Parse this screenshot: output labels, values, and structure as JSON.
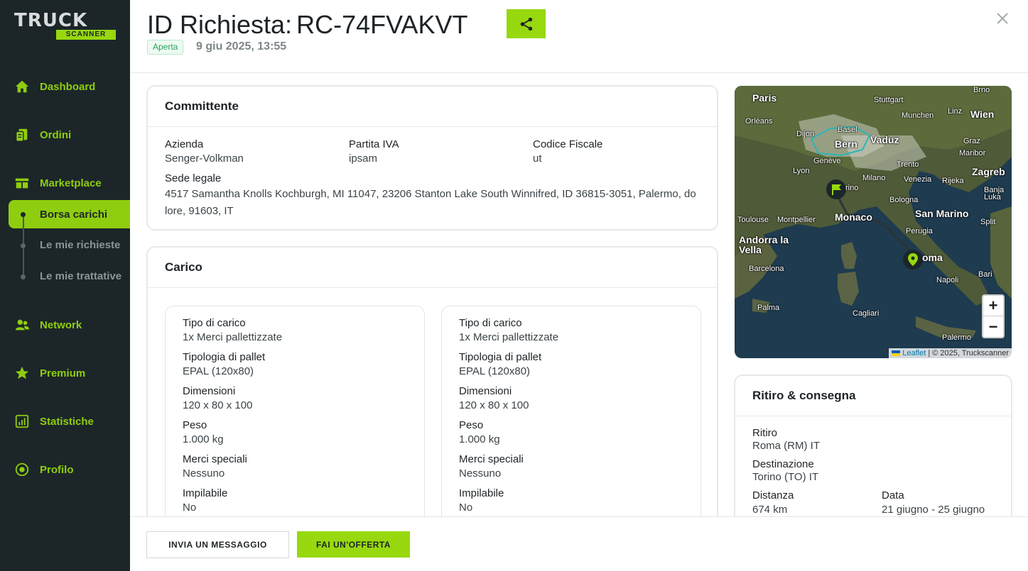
{
  "sidebar": {
    "logo_top": "TRUCK",
    "logo_bottom": "SCANNER",
    "items": [
      {
        "label": "Dashboard",
        "icon": "home-icon"
      },
      {
        "label": "Ordini",
        "icon": "orders-icon"
      },
      {
        "label": "Marketplace",
        "icon": "marketplace-icon"
      },
      {
        "label": "Network",
        "icon": "network-icon"
      },
      {
        "label": "Premium",
        "icon": "star-icon"
      },
      {
        "label": "Statistiche",
        "icon": "chart-icon"
      },
      {
        "label": "Profilo",
        "icon": "profile-icon"
      }
    ],
    "sub_items": [
      {
        "label": "Borsa carichi",
        "active": true
      },
      {
        "label": "Le mie richieste",
        "active": false
      },
      {
        "label": "Le mie trattative",
        "active": false
      }
    ]
  },
  "header": {
    "title": "ID Richiesta:",
    "request_id": "RC-74FVAKVT",
    "status": "Aperta",
    "date": "9 giu 2025, 13:55"
  },
  "committente": {
    "title": "Committente",
    "azienda_label": "Azienda",
    "azienda_value": "Senger-Volkman",
    "piva_label": "Partita IVA",
    "piva_value": "ipsam",
    "cf_label": "Codice Fiscale",
    "cf_value": "ut",
    "sede_label": "Sede legale",
    "sede_value": "4517 Samantha Knolls Kochburgh, MI 11047, 23206 Stanton Lake South Winnifred, ID 36815-3051, Palermo, do lore, 91603, IT"
  },
  "carico": {
    "title": "Carico",
    "items": [
      {
        "tipo_label": "Tipo di carico",
        "tipo_value": "1x Merci pallettizzate",
        "pallet_label": "Tipologia di pallet",
        "pallet_value": "EPAL (120x80)",
        "dim_label": "Dimensioni",
        "dim_value": "120 x 80 x 100",
        "peso_label": "Peso",
        "peso_value": "1.000 kg",
        "speciali_label": "Merci speciali",
        "speciali_value": "Nessuno",
        "impilabile_label": "Impilabile",
        "impilabile_value": "No"
      },
      {
        "tipo_label": "Tipo di carico",
        "tipo_value": "1x Merci pallettizzate",
        "pallet_label": "Tipologia di pallet",
        "pallet_value": "EPAL (120x80)",
        "dim_label": "Dimensioni",
        "dim_value": "120 x 80 x 100",
        "peso_label": "Peso",
        "peso_value": "1.000 kg",
        "speciali_label": "Merci speciali",
        "speciali_value": "Nessuno",
        "impilabile_label": "Impilabile",
        "impilabile_value": "No"
      }
    ]
  },
  "map": {
    "labels": [
      "Paris",
      "Stuttgart",
      "Brno",
      "Munchen",
      "Linz",
      "Wien",
      "Orléans",
      "Basel",
      "Dijon",
      "Vaduz",
      "Bern",
      "Graz",
      "Maribor",
      "Genève",
      "Trento",
      "Zagreb",
      "Lyon",
      "Milano",
      "Venezia",
      "Rijeka",
      "rino",
      "Banja Luka",
      "Bologna",
      "Toulouse",
      "Montpellier",
      "Monaco",
      "San Marino",
      "Split",
      "Perugia",
      "Andorra la Vella",
      "oma",
      "Barcelona",
      "Bari",
      "Napoli",
      "Palma",
      "Cagliari",
      "Palermo"
    ],
    "zoom_in": "+",
    "zoom_out": "−",
    "attribution_link": "Leaflet",
    "attribution_text": "| © 2025, Truckscanner"
  },
  "ritiro": {
    "title": "Ritiro & consegna",
    "ritiro_label": "Ritiro",
    "ritiro_value": "Roma (RM) IT",
    "destinazione_label": "Destinazione",
    "destinazione_value": "Torino (TO) IT",
    "distanza_label": "Distanza",
    "distanza_value": "674 km",
    "data_label": "Data",
    "data_value": "21 giugno - 25 giugno"
  },
  "footer": {
    "message_button": "INVIA UN MESSAGGIO",
    "offer_button": "FAI UN'OFFERTA"
  },
  "colors": {
    "accent": "#97d80f",
    "sidebar_bg": "#1c2629",
    "status_green": "#27a35c"
  }
}
